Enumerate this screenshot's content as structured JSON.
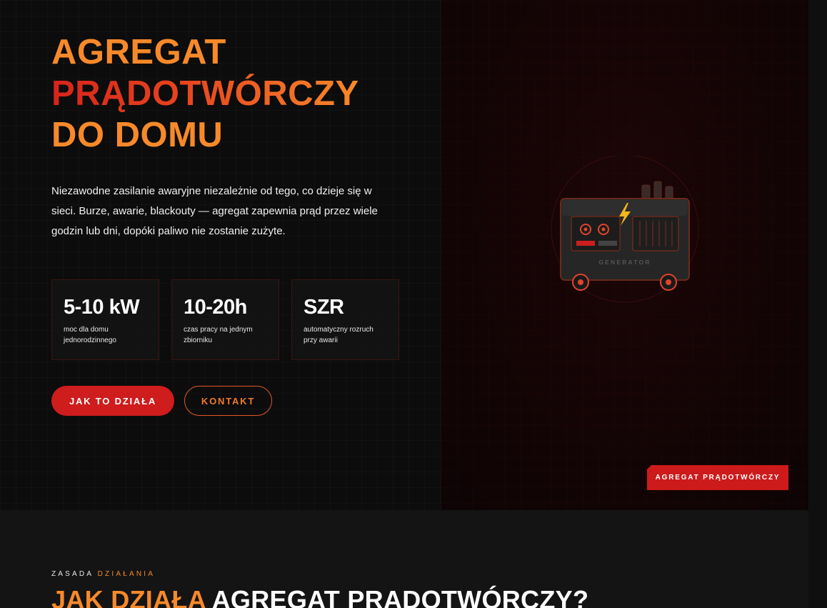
{
  "hero": {
    "title_line1": "AGREGAT",
    "title_line2": "PRĄDOTWÓRCZY",
    "title_line3": "DO DOMU",
    "lead": "Niezawodne zasilanie awaryjne niezależnie od tego, co dzieje się w sieci. Burze, awarie, blackouty — agregat zapewnia prąd przez wiele godzin lub dni, dopóki paliwo nie zostanie zużyte.",
    "stats": [
      {
        "value": "5-10 kW",
        "label": "moc dla domu jednorodzinnego"
      },
      {
        "value": "10-20h",
        "label": "czas pracy na jednym zbiorniku"
      },
      {
        "value": "SZR",
        "label": "automatyczny rozruch przy awarii"
      }
    ],
    "primary_button": "JAK TO DZIAŁA",
    "secondary_button": "KONTAKT",
    "generator_label": "GENERATOR",
    "tag": "AGREGAT PRĄDOTWÓRCZY"
  },
  "section2": {
    "eyebrow_part1": "ZASADA ",
    "eyebrow_part2": "DZIAŁANIA",
    "heading_accent": "JAK DZIAŁA",
    "heading_rest": " AGREGAT PRĄDOTWÓRCZY?"
  },
  "colors": {
    "accent_orange": "#f7892a",
    "accent_red": "#cf1c1d",
    "background": "#0c0c0c"
  }
}
